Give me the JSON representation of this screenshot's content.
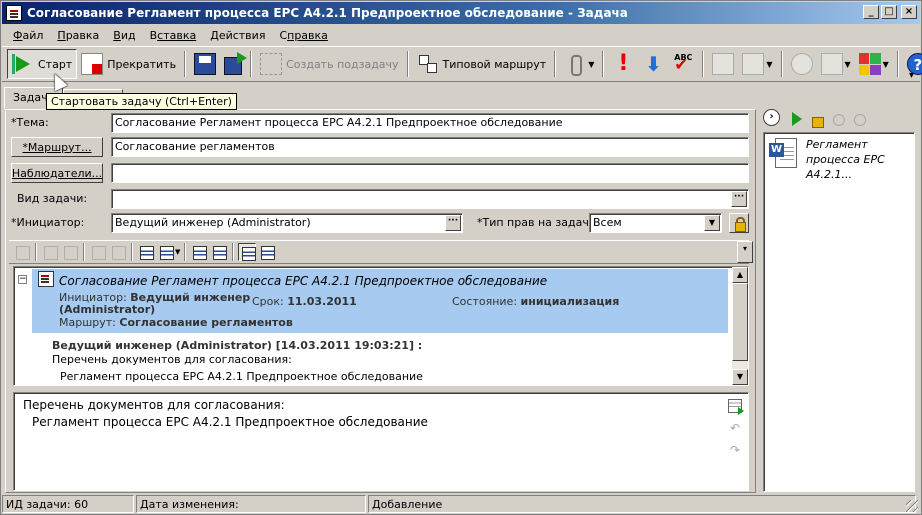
{
  "window": {
    "title": "Согласование Регламент процесса EPC A4.2.1 Предпроектное обследование - Задача"
  },
  "menu": [
    {
      "label": "Файл",
      "key": "Ф",
      "rest": "айл"
    },
    {
      "label": "Правка",
      "key": "П",
      "rest": "равка"
    },
    {
      "label": "Вид",
      "key": "В",
      "rest": "ид"
    },
    {
      "label": "Вставка",
      "key": "В",
      "rest": "ставка"
    },
    {
      "label": "Действия",
      "key": "Д",
      "rest": "ействия"
    },
    {
      "label": "Справка",
      "key": "С",
      "rest": "правка"
    }
  ],
  "toolbar": {
    "start_label": "Старт",
    "stop_label": "Прекратить",
    "create_subtask_label": "Создать подзадачу",
    "template_route_label": "Типовой маршрут"
  },
  "tooltip": "Стартовать задачу (Ctrl+Enter)",
  "tabs": {
    "task_label": "Задача"
  },
  "form": {
    "subject_label": "*Тема:",
    "subject_value": "Согласование Регламент процесса EPC A4.2.1 Предпроектное обследование",
    "route_button": "*Маршрут...",
    "route_value": "Согласование регламентов",
    "observers_button": "Наблюдатели...",
    "observers_value": "",
    "task_kind_label": "Вид задачи:",
    "task_kind_value": "",
    "initiator_label": "*Инициатор:",
    "initiator_value": "Ведущий инженер (Administrator)",
    "rights_label": "*Тип прав на задачу:",
    "rights_value": "Всем"
  },
  "tree": {
    "toggle": "−",
    "title": "Согласование Регламент процесса EPC A4.2.1 Предпроектное обследование",
    "initiator_label": "Инициатор:",
    "initiator_value_line1": "Ведущий инженер",
    "initiator_value_line2": "(Administrator)",
    "deadline_label": "Срок:",
    "deadline_value": "11.03.2011",
    "state_label": "Состояние:",
    "state_value": "инициализация",
    "route_label": "Маршрут:",
    "route_value": "Согласование регламентов",
    "comment_author": "Ведущий инженер (Administrator) [14.03.2011 19:03:21] :",
    "comment_line1": "Перечень документов для согласования:",
    "comment_line2": "Регламент процесса EPC A4.2.1 Предпроектное обследование"
  },
  "editor": {
    "line1": "Перечень документов для согласования:",
    "line2": "Регламент процесса EPC A4.2.1 Предпроектное обследование"
  },
  "attachments": [
    {
      "name": "Регламент процесса EPC A4.2.1...",
      "icon": "word-document-icon"
    }
  ],
  "status": {
    "task_id": "ИД задачи: 60",
    "modified": "Дата изменения:",
    "mode": "Добавление"
  },
  "colors": {
    "selection": "#a6caf0",
    "title_bar_start": "#0a246a",
    "start_icon": "#1a9a1a",
    "stop_icon": "#dd0000"
  }
}
